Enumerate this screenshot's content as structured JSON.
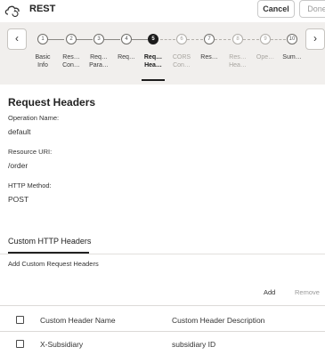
{
  "header": {
    "title": "REST",
    "cancel_label": "Cancel",
    "done_label": "Done",
    "icon": "cloud-sync-icon"
  },
  "train": {
    "prev_icon": "chevron-left-icon",
    "next_icon": "chevron-right-icon",
    "prev_glyph": "‹",
    "next_glyph": "›",
    "steps": [
      {
        "number": "1",
        "label1": "Basic",
        "label2": "Info",
        "state": "done"
      },
      {
        "number": "2",
        "label1": "Res…",
        "label2": "Con…",
        "state": "done"
      },
      {
        "number": "3",
        "label1": "Req…",
        "label2": "Para…",
        "state": "done"
      },
      {
        "number": "4",
        "label1": "Req…",
        "label2": "",
        "state": "done"
      },
      {
        "number": "5",
        "label1": "Req…",
        "label2": "Hea…",
        "state": "current"
      },
      {
        "number": "6",
        "label1": "CORS",
        "label2": "Con…",
        "state": "future"
      },
      {
        "number": "7",
        "label1": "Res…",
        "label2": "",
        "state": "done"
      },
      {
        "number": "8",
        "label1": "Res…",
        "label2": "Hea…",
        "state": "future"
      },
      {
        "number": "9",
        "label1": "Ope…",
        "label2": "",
        "state": "future"
      },
      {
        "number": "10",
        "label1": "Sum…",
        "label2": "",
        "state": "done"
      }
    ]
  },
  "section": {
    "title": "Request Headers",
    "operation_name_label": "Operation Name:",
    "operation_name_value": "default",
    "resource_uri_label": "Resource URI:",
    "resource_uri_value": "/order",
    "http_method_label": "HTTP Method:",
    "http_method_value": "POST"
  },
  "tabs": {
    "active_label": "Custom HTTP Headers",
    "add_headers_text": "Add Custom Request Headers"
  },
  "toolbar": {
    "add_label": "Add",
    "remove_label": "Remove"
  },
  "table": {
    "columns": [
      "Custom Header Name",
      "Custom Header Description"
    ],
    "rows": [
      {
        "name": "X-Subsidiary",
        "description": "subsidiary ID"
      }
    ]
  }
}
